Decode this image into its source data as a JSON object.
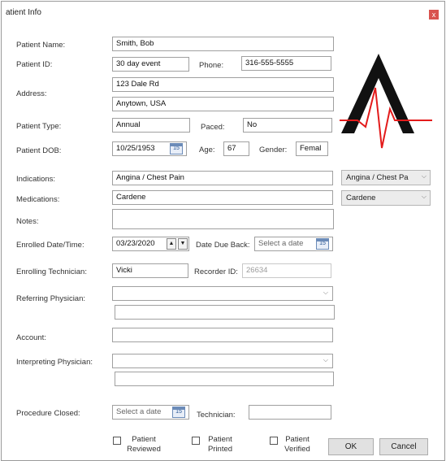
{
  "window": {
    "title": "atient Info",
    "close": "x"
  },
  "labels": {
    "patient_name": "Patient Name:",
    "patient_id": "Patient ID:",
    "phone": "Phone:",
    "address": "Address:",
    "patient_type": "Patient Type:",
    "paced": "Paced:",
    "patient_dob": "Patient DOB:",
    "age": "Age:",
    "gender": "Gender:",
    "indications": "Indications:",
    "medications": "Medications:",
    "notes": "Notes:",
    "enrolled": "Enrolled Date/Time:",
    "date_due_back": "Date Due Back:",
    "enrolling_tech": "Enrolling Technician:",
    "recorder_id": "Recorder ID:",
    "referring_physician": "Referring Physician:",
    "account": "Account:",
    "interpreting_physician": "Interpreting Physician:",
    "procedure_closed": "Procedure Closed:",
    "technician": "Technician:"
  },
  "values": {
    "patient_name": "Smith, Bob",
    "patient_id": "30 day event",
    "phone": "316-555-5555",
    "address1": "123 Dale Rd",
    "address2": "Anytown, USA",
    "patient_type": "Annual",
    "paced": "No",
    "dob": "10/25/1953",
    "age": "67",
    "gender": "Femal",
    "indications": "Angina / Chest Pain",
    "medications": "Cardene",
    "notes": "",
    "enrolled": "03/23/2020",
    "date_due_back": "Select a date",
    "enrolling_tech": "Vicki",
    "recorder_id": "26634",
    "referring_physician": "",
    "referring_extra": "",
    "account": "",
    "interpreting_physician": "",
    "interpreting_extra": "",
    "procedure_closed": "Select a date",
    "technician": ""
  },
  "combos": {
    "indications": "Angina / Chest Pa",
    "medications": "Cardene"
  },
  "calendar_icon_text": "15",
  "checkboxes": [
    {
      "line1": "Patient",
      "line2": "Reviewed"
    },
    {
      "line1": "Patient",
      "line2": "Printed"
    },
    {
      "line1": "Patient",
      "line2": "Verified"
    }
  ],
  "buttons": {
    "ok": "OK",
    "cancel": "Cancel"
  },
  "colors": {
    "logo_black": "#111111",
    "logo_red": "#e31b1b",
    "close_red": "#d9534f"
  }
}
